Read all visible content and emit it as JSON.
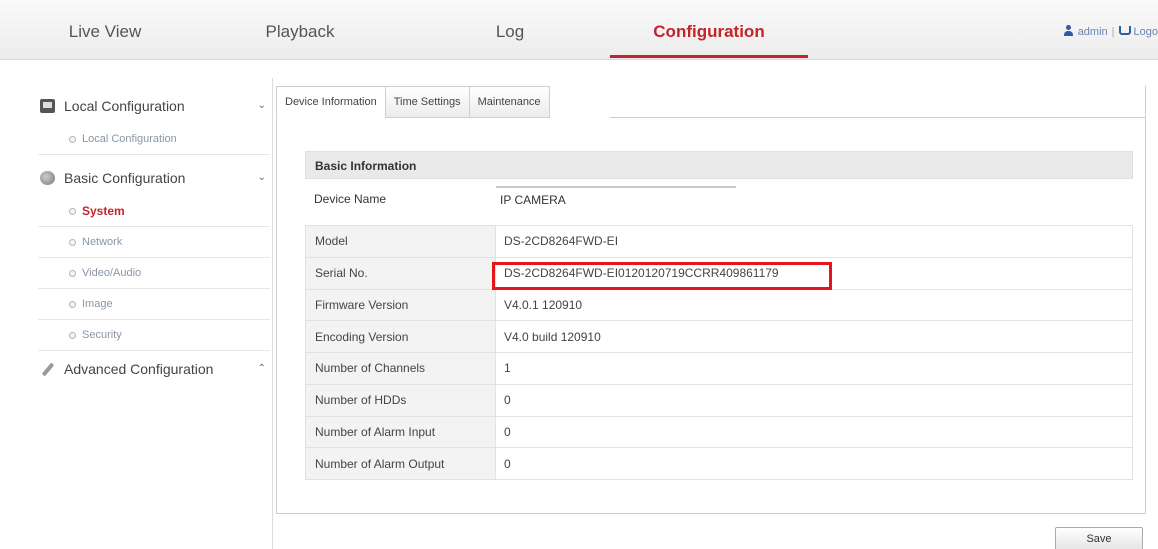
{
  "topnav": {
    "tabs": [
      {
        "label": "Live View"
      },
      {
        "label": "Playback"
      },
      {
        "label": "Log"
      },
      {
        "label": "Configuration"
      }
    ],
    "active": "Configuration",
    "user": "admin",
    "separator": "|",
    "logout": "Logo"
  },
  "sidebar": {
    "local": {
      "label": "Local Configuration",
      "arrow": "⌄",
      "items": [
        "Local Configuration"
      ]
    },
    "basic": {
      "label": "Basic Configuration",
      "arrow": "⌄",
      "items": [
        "System",
        "Network",
        "Video/Audio",
        "Image",
        "Security"
      ],
      "active": "System"
    },
    "advanced": {
      "label": "Advanced Configuration",
      "arrow": "⌃"
    }
  },
  "tabs": [
    "Device Information",
    "Time Settings",
    "Maintenance"
  ],
  "active_tab": "Device Information",
  "section": {
    "title": "Basic Information"
  },
  "device_name": {
    "label": "Device Name",
    "value": "IP CAMERA"
  },
  "info": [
    {
      "key": "Model",
      "value": "DS-2CD8264FWD-EI"
    },
    {
      "key": "Serial No.",
      "value": "DS-2CD8264FWD-EI0120120719CCRR409861179"
    },
    {
      "key": "Firmware Version",
      "value": "V4.0.1 120910"
    },
    {
      "key": "Encoding Version",
      "value": "V4.0 build 120910"
    },
    {
      "key": "Number of Channels",
      "value": "1"
    },
    {
      "key": "Number of HDDs",
      "value": "0"
    },
    {
      "key": "Number of Alarm Input",
      "value": "0"
    },
    {
      "key": "Number of Alarm Output",
      "value": "0"
    }
  ],
  "save_label": "Save",
  "colors": {
    "accent": "#c1242a",
    "highlight": "#e8141b"
  }
}
